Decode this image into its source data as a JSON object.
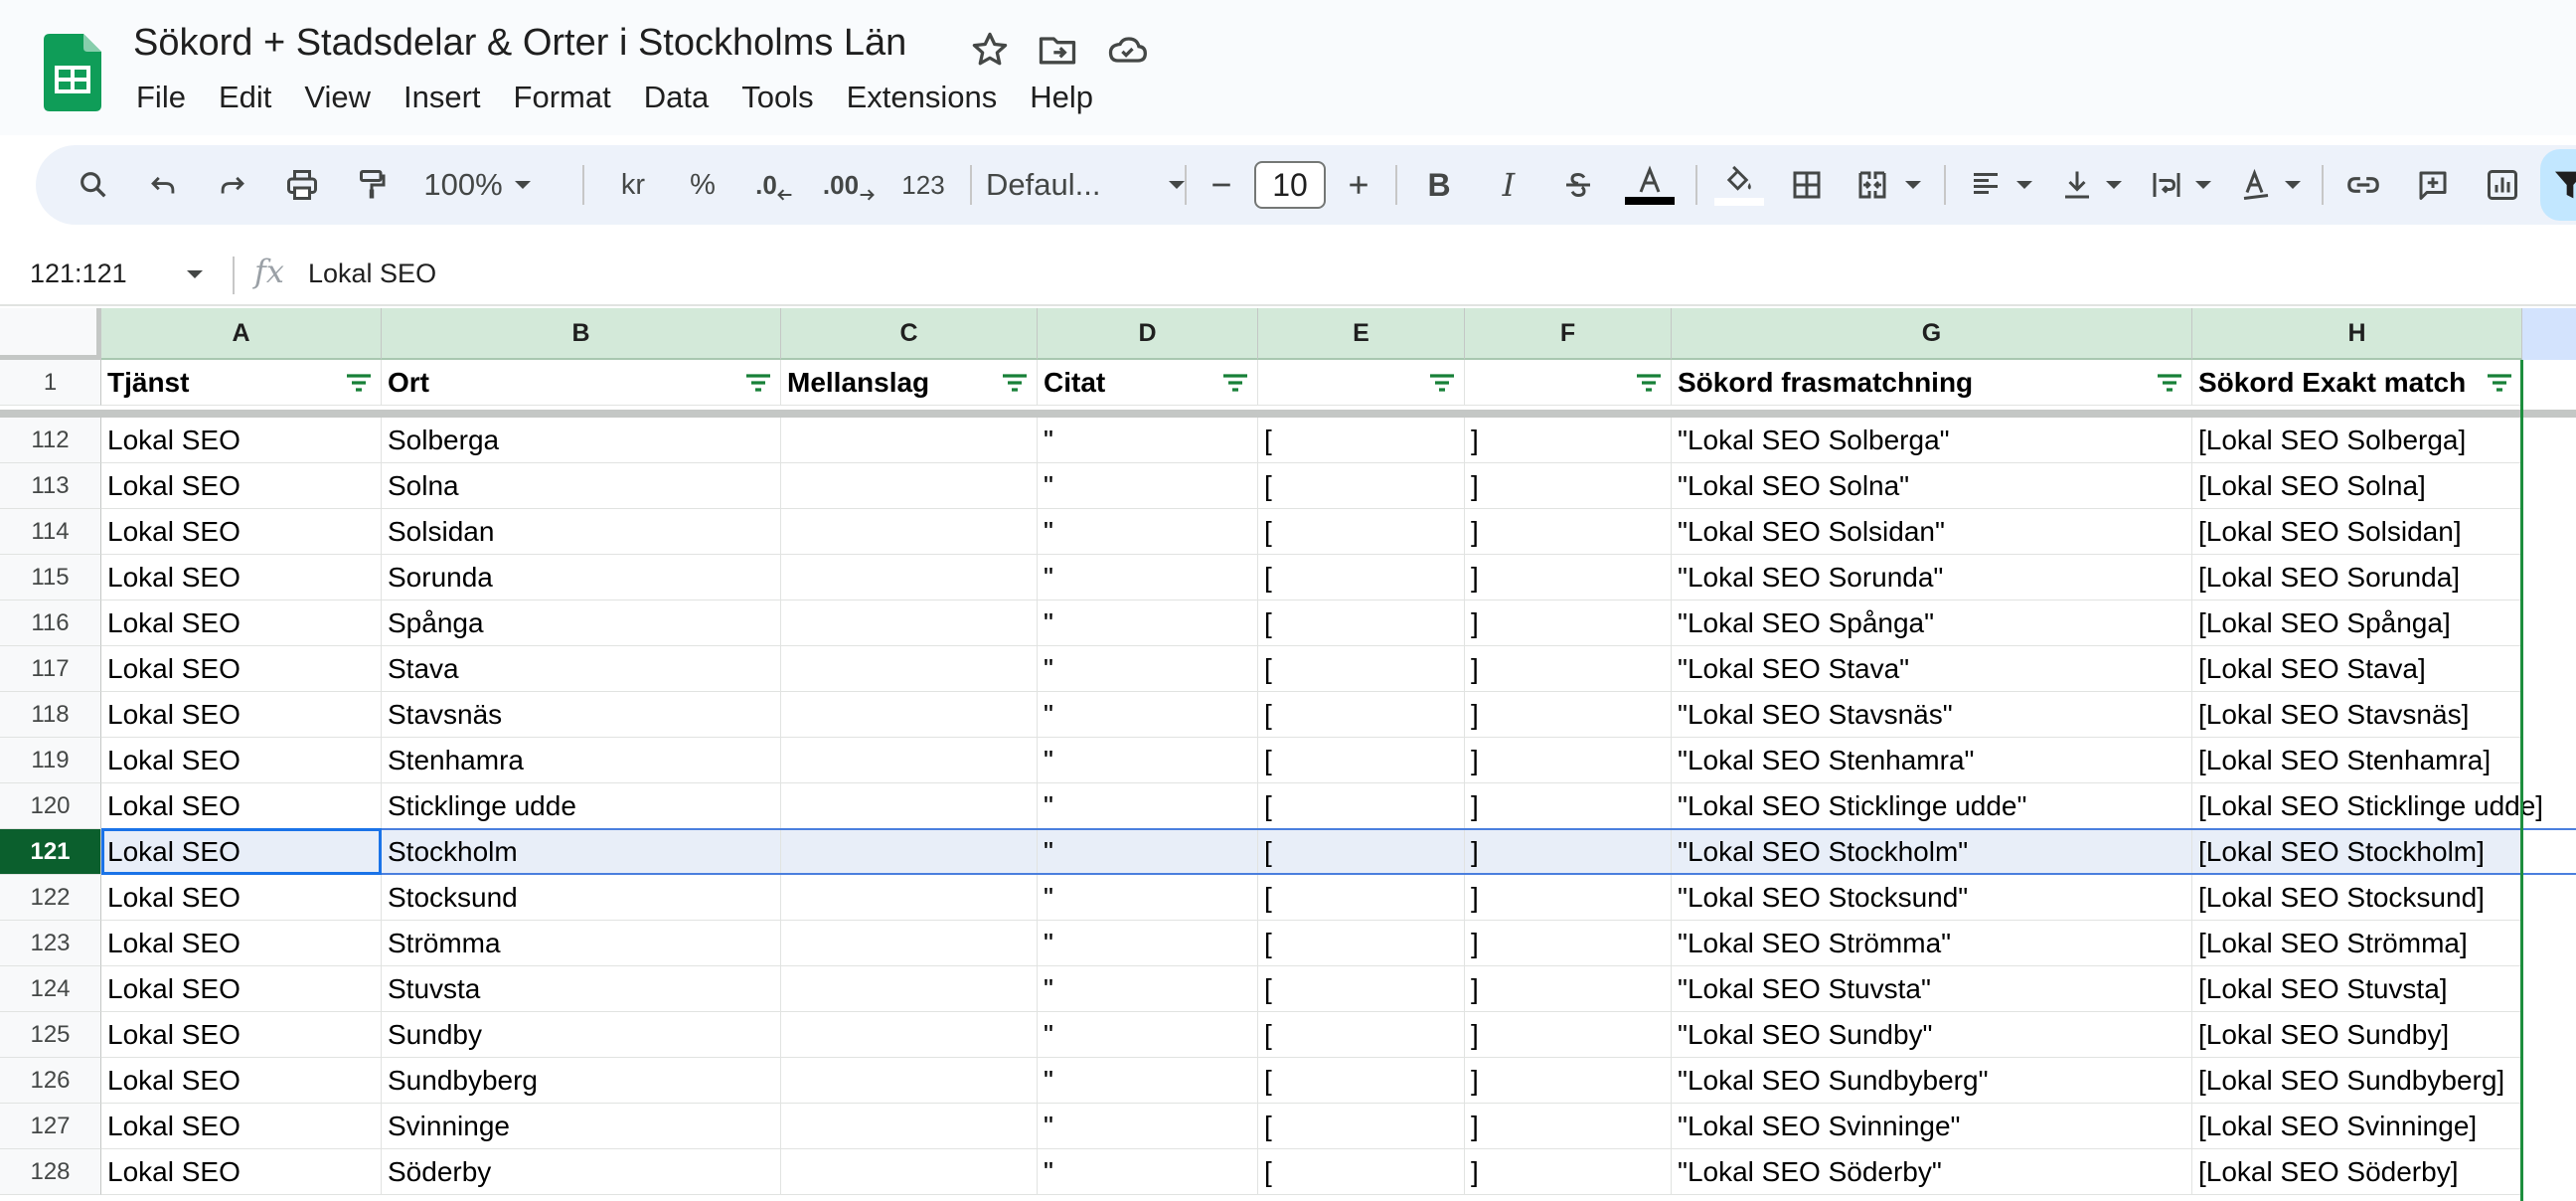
{
  "document": {
    "title": "Sökord + Stadsdelar & Orter i Stockholms Län"
  },
  "menu": [
    "File",
    "Edit",
    "View",
    "Insert",
    "Format",
    "Data",
    "Tools",
    "Extensions",
    "Help"
  ],
  "toolbar": {
    "zoom": "100%",
    "currency": "kr",
    "percent": "%",
    "decrease_decimals": ".0",
    "increase_decimals": ".00",
    "number_format": "123",
    "font": "Defaul...",
    "font_size": "10",
    "bold": "B",
    "italic": "I"
  },
  "formula_bar": {
    "name_box": "121:121",
    "value": "Lokal SEO"
  },
  "columns": [
    "A",
    "B",
    "C",
    "D",
    "E",
    "F",
    "G",
    "H"
  ],
  "header_row": {
    "number": "1",
    "cells": [
      "Tjänst",
      "Ort",
      "Mellanslag",
      "Citat",
      "",
      "",
      "Sökord frasmatchning",
      "Sökord Exakt match"
    ]
  },
  "rows": [
    {
      "number": "112",
      "cells": [
        "Lokal SEO",
        "Solberga",
        "",
        "\"",
        "[",
        "]",
        "\"Lokal SEO Solberga\"",
        "[Lokal SEO Solberga]"
      ]
    },
    {
      "number": "113",
      "cells": [
        "Lokal SEO",
        "Solna",
        "",
        "\"",
        "[",
        "]",
        "\"Lokal SEO Solna\"",
        "[Lokal SEO Solna]"
      ]
    },
    {
      "number": "114",
      "cells": [
        "Lokal SEO",
        "Solsidan",
        "",
        "\"",
        "[",
        "]",
        "\"Lokal SEO Solsidan\"",
        "[Lokal SEO Solsidan]"
      ]
    },
    {
      "number": "115",
      "cells": [
        "Lokal SEO",
        "Sorunda",
        "",
        "\"",
        "[",
        "]",
        "\"Lokal SEO Sorunda\"",
        "[Lokal SEO Sorunda]"
      ]
    },
    {
      "number": "116",
      "cells": [
        "Lokal SEO",
        "Spånga",
        "",
        "\"",
        "[",
        "]",
        "\"Lokal SEO Spånga\"",
        "[Lokal SEO Spånga]"
      ]
    },
    {
      "number": "117",
      "cells": [
        "Lokal SEO",
        "Stava",
        "",
        "\"",
        "[",
        "]",
        "\"Lokal SEO Stava\"",
        "[Lokal SEO Stava]"
      ]
    },
    {
      "number": "118",
      "cells": [
        "Lokal SEO",
        "Stavsnäs",
        "",
        "\"",
        "[",
        "]",
        "\"Lokal SEO Stavsnäs\"",
        "[Lokal SEO Stavsnäs]"
      ]
    },
    {
      "number": "119",
      "cells": [
        "Lokal SEO",
        "Stenhamra",
        "",
        "\"",
        "[",
        "]",
        "\"Lokal SEO Stenhamra\"",
        "[Lokal SEO Stenhamra]"
      ]
    },
    {
      "number": "120",
      "cells": [
        "Lokal SEO",
        "Sticklinge udde",
        "",
        "\"",
        "[",
        "]",
        "\"Lokal SEO Sticklinge udde\"",
        "[Lokal SEO Sticklinge udde]"
      ]
    },
    {
      "number": "121",
      "cells": [
        "Lokal SEO",
        "Stockholm",
        "",
        "\"",
        "[",
        "]",
        "\"Lokal SEO Stockholm\"",
        "[Lokal SEO Stockholm]"
      ]
    },
    {
      "number": "122",
      "cells": [
        "Lokal SEO",
        "Stocksund",
        "",
        "\"",
        "[",
        "]",
        "\"Lokal SEO Stocksund\"",
        "[Lokal SEO Stocksund]"
      ]
    },
    {
      "number": "123",
      "cells": [
        "Lokal SEO",
        "Strömma",
        "",
        "\"",
        "[",
        "]",
        "\"Lokal SEO Strömma\"",
        "[Lokal SEO Strömma]"
      ]
    },
    {
      "number": "124",
      "cells": [
        "Lokal SEO",
        "Stuvsta",
        "",
        "\"",
        "[",
        "]",
        "\"Lokal SEO Stuvsta\"",
        "[Lokal SEO Stuvsta]"
      ]
    },
    {
      "number": "125",
      "cells": [
        "Lokal SEO",
        "Sundby",
        "",
        "\"",
        "[",
        "]",
        "\"Lokal SEO Sundby\"",
        "[Lokal SEO Sundby]"
      ]
    },
    {
      "number": "126",
      "cells": [
        "Lokal SEO",
        "Sundbyberg",
        "",
        "\"",
        "[",
        "]",
        "\"Lokal SEO Sundbyberg\"",
        "[Lokal SEO Sundbyberg]"
      ]
    },
    {
      "number": "127",
      "cells": [
        "Lokal SEO",
        "Svinninge",
        "",
        "\"",
        "[",
        "]",
        "\"Lokal SEO Svinninge\"",
        "[Lokal SEO Svinninge]"
      ]
    },
    {
      "number": "128",
      "cells": [
        "Lokal SEO",
        "Söderby",
        "",
        "\"",
        "[",
        "]",
        "\"Lokal SEO Söderby\"",
        "[Lokal SEO Söderby]"
      ]
    }
  ],
  "selected_row": "121",
  "colors": {
    "sheets_green": "#0f9d58",
    "header_fill": "#d3e9d9",
    "selection_blue": "#1a73e8"
  }
}
